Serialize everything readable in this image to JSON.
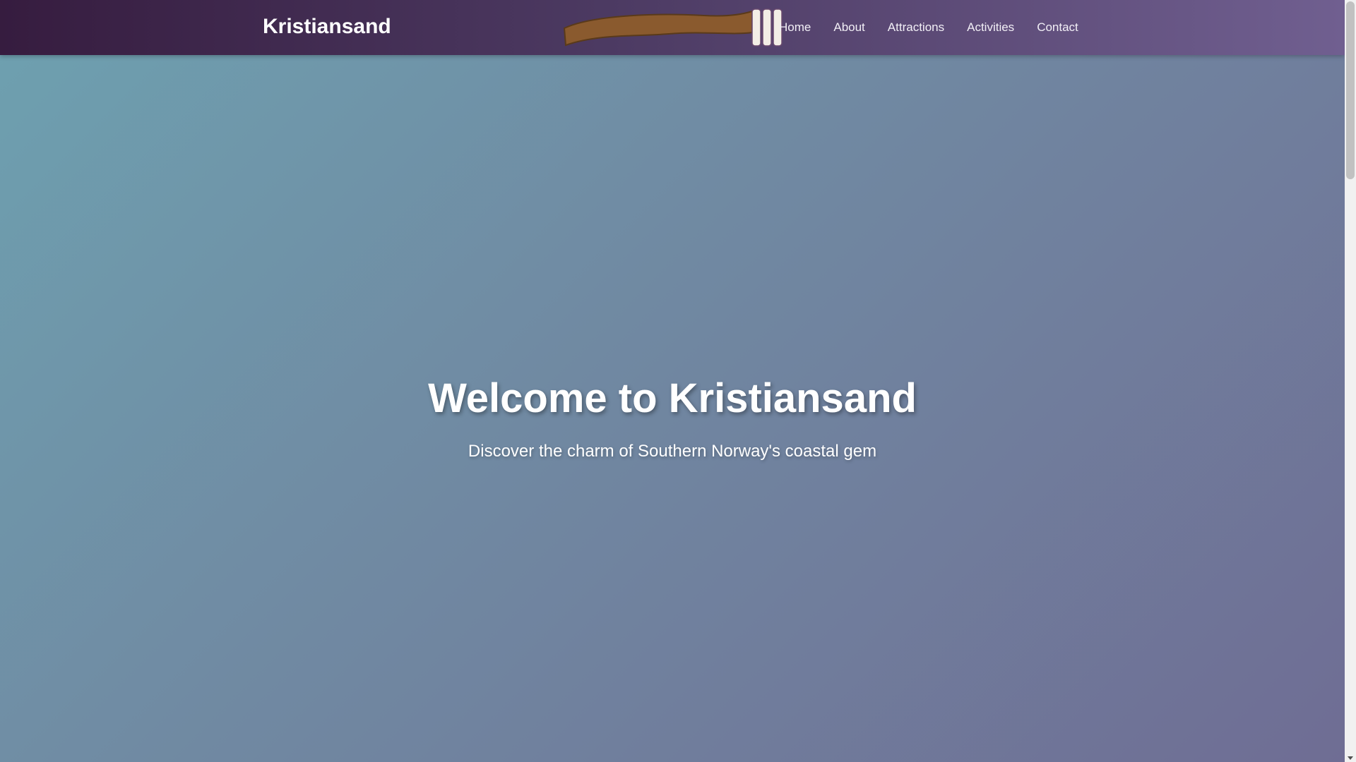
{
  "header": {
    "brand": "Kristiansand",
    "logo_icon": "viking-ship-icon",
    "nav": [
      {
        "label": "Home"
      },
      {
        "label": "About"
      },
      {
        "label": "Attractions"
      },
      {
        "label": "Activities"
      },
      {
        "label": "Contact"
      }
    ]
  },
  "hero": {
    "title": "Welcome to Kristiansand",
    "subtitle": "Discover the charm of Southern Norway's coastal gem"
  },
  "colors": {
    "nav_start": "#361c3f",
    "nav_end": "#705f90",
    "hero_start": "#6ea1b0",
    "hero_end": "#6f6d94",
    "logo_brown": "#8a5a2e"
  }
}
